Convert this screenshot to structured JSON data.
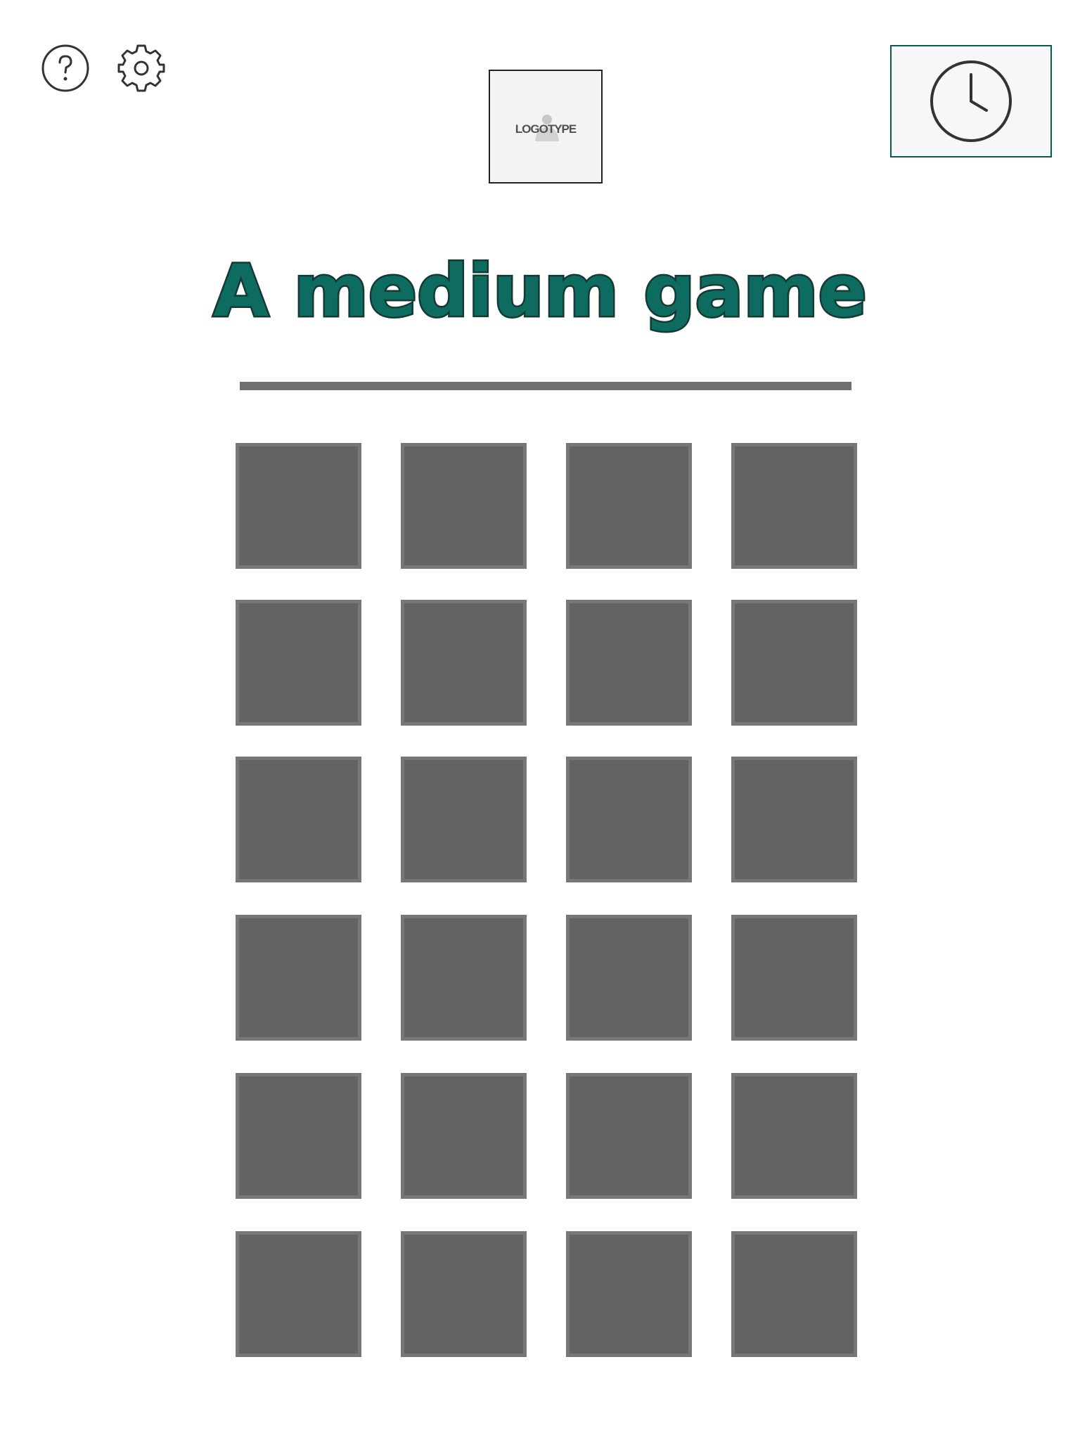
{
  "header": {
    "help_icon": "help-circle-icon",
    "settings_icon": "gear-icon",
    "logo": {
      "text": "LOGOTYPE"
    },
    "timer_icon": "clock-icon"
  },
  "game": {
    "title": "A medium game",
    "grid": {
      "rows": 6,
      "columns": 4,
      "cards": [
        {
          "state": "face-down"
        },
        {
          "state": "face-down"
        },
        {
          "state": "face-down"
        },
        {
          "state": "face-down"
        },
        {
          "state": "face-down"
        },
        {
          "state": "face-down"
        },
        {
          "state": "face-down"
        },
        {
          "state": "face-down"
        },
        {
          "state": "face-down"
        },
        {
          "state": "face-down"
        },
        {
          "state": "face-down"
        },
        {
          "state": "face-down"
        },
        {
          "state": "face-down"
        },
        {
          "state": "face-down"
        },
        {
          "state": "face-down"
        },
        {
          "state": "face-down"
        },
        {
          "state": "face-down"
        },
        {
          "state": "face-down"
        },
        {
          "state": "face-down"
        },
        {
          "state": "face-down"
        },
        {
          "state": "face-down"
        },
        {
          "state": "face-down"
        },
        {
          "state": "face-down"
        },
        {
          "state": "face-down"
        }
      ]
    }
  },
  "colors": {
    "accent": "#0e6b5f",
    "card_face_down": "#636363",
    "card_border": "#777777",
    "divider": "#707070"
  }
}
